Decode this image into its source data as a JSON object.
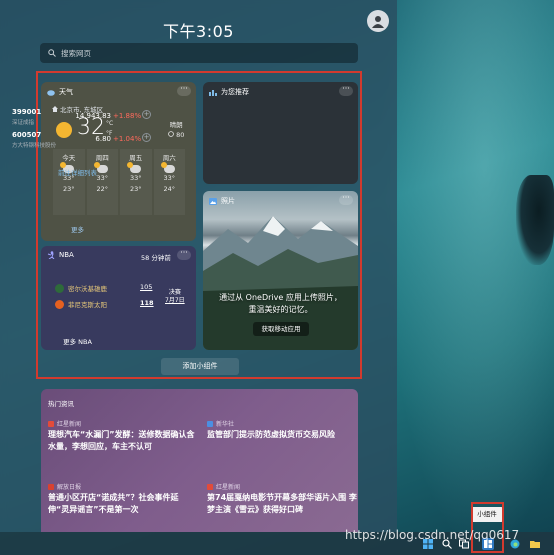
{
  "clock": "下午3:05",
  "search": {
    "placeholder": "搜索网页"
  },
  "weather": {
    "title": "天气",
    "location": "北京市, 东城区",
    "temp": "32",
    "unit_c": "°C",
    "unit_f": "°F",
    "condition": "晴朗",
    "aqi": "80",
    "forecast": [
      {
        "day": "今天",
        "high": "33°",
        "low": "23°"
      },
      {
        "day": "周四",
        "high": "33°",
        "low": "22°"
      },
      {
        "day": "周五",
        "high": "33°",
        "low": "23°"
      },
      {
        "day": "周六",
        "high": "33°",
        "low": "24°"
      }
    ],
    "more": "更多"
  },
  "stocks": {
    "title": "为您推荐",
    "rows": [
      {
        "code": "399001",
        "name": "深证成指",
        "price": "14,943.83",
        "change": "+1.88%"
      },
      {
        "code": "600507",
        "name": "方大特钢科技股份",
        "price": "6.80",
        "change": "+1.04%"
      }
    ],
    "link": "前往详细列表"
  },
  "nba": {
    "title": "NBA",
    "time": "58 分钟前",
    "teams": [
      {
        "name": "密尔沃基雄鹿",
        "score": "105"
      },
      {
        "name": "菲尼克斯太阳",
        "score": "118"
      }
    ],
    "status": "决赛",
    "date": "7月7日",
    "more": "更多 NBA"
  },
  "photos": {
    "title": "照片",
    "text_line1": "通过从 OneDrive 应用上传照片，",
    "text_line2": "重温美好的记忆。",
    "button": "获取移动应用"
  },
  "add_widget": "添加小组件",
  "news": {
    "title": "热门资讯",
    "items": [
      {
        "source": "红星新闻",
        "headline": "理想汽车“水漏门”发酵：送修数据确认含水量，李想回应，车主不认可"
      },
      {
        "source": "新华社",
        "headline": "监管部门提示防范虚拟货币交易风险"
      },
      {
        "source": "解放日报",
        "headline": "普通小区开店“诺成共”？社会事件延伸“灵异谣言”不是第一次"
      },
      {
        "source": "红星新闻",
        "headline": "第74届戛纳电影节开幕多部华语片入围 李梦主演《雪云》获得好口碑"
      }
    ]
  },
  "taskbar": {
    "tooltip": "小组件"
  },
  "watermark": "https://blog.csdn.net/qq0617"
}
